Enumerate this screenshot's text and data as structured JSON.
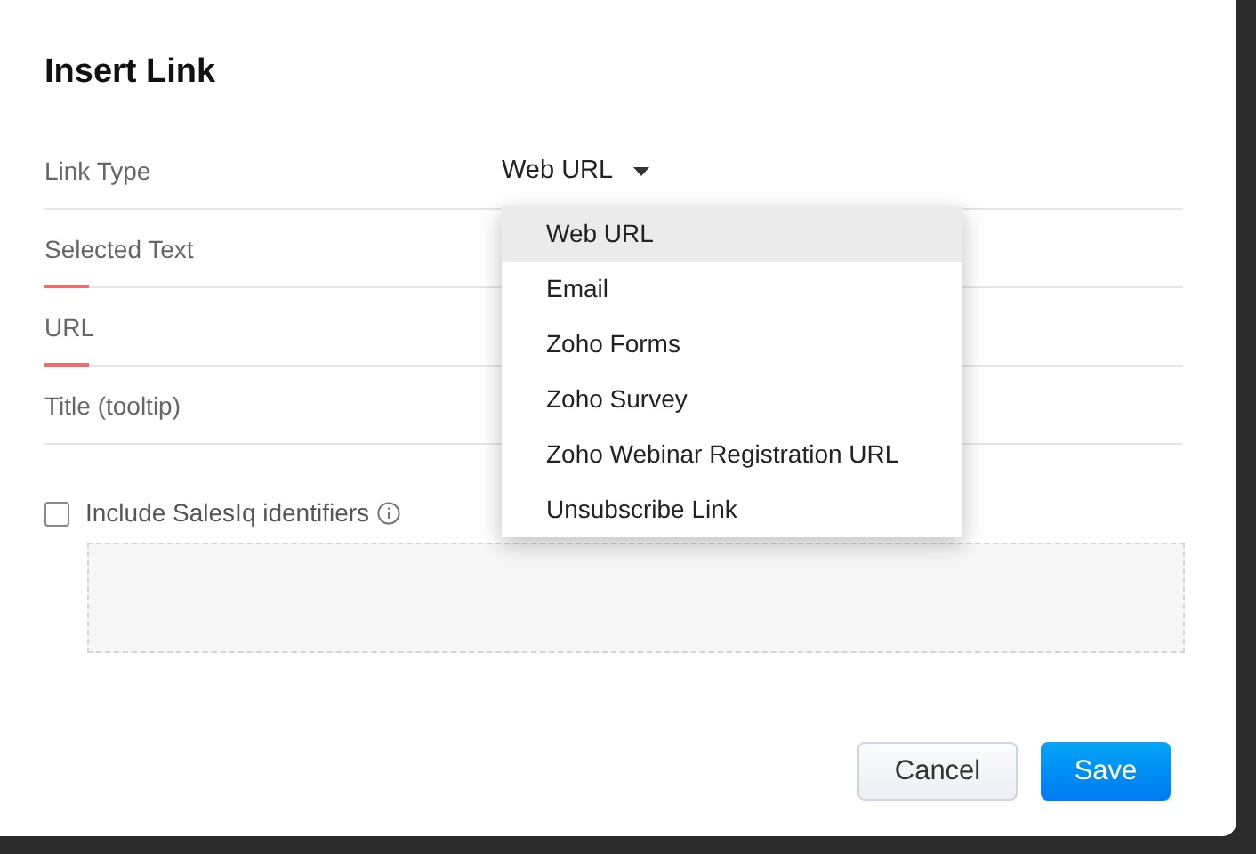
{
  "dialog": {
    "title": "Insert Link",
    "fields": [
      {
        "kind": "select",
        "label": "Link Type",
        "value": "Web URL",
        "required": false
      },
      {
        "kind": "text",
        "label": "Selected Text",
        "required": true
      },
      {
        "kind": "text",
        "label": "URL",
        "required": true
      },
      {
        "kind": "text",
        "label": "Title (tooltip)",
        "required": false
      }
    ],
    "dropdown": [
      {
        "label": "Web URL",
        "selected": true
      },
      {
        "label": "Email",
        "selected": false
      },
      {
        "label": "Zoho Forms",
        "selected": false
      },
      {
        "label": "Zoho Survey",
        "selected": false
      },
      {
        "label": "Zoho Webinar Registration URL",
        "selected": false
      },
      {
        "label": "Unsubscribe Link",
        "selected": false
      }
    ],
    "checkbox": {
      "label": "Include SalesIq identifiers",
      "checked": false
    },
    "buttons": [
      {
        "kind": "secondary",
        "label": "Cancel"
      },
      {
        "kind": "primary",
        "label": "Save"
      }
    ]
  }
}
